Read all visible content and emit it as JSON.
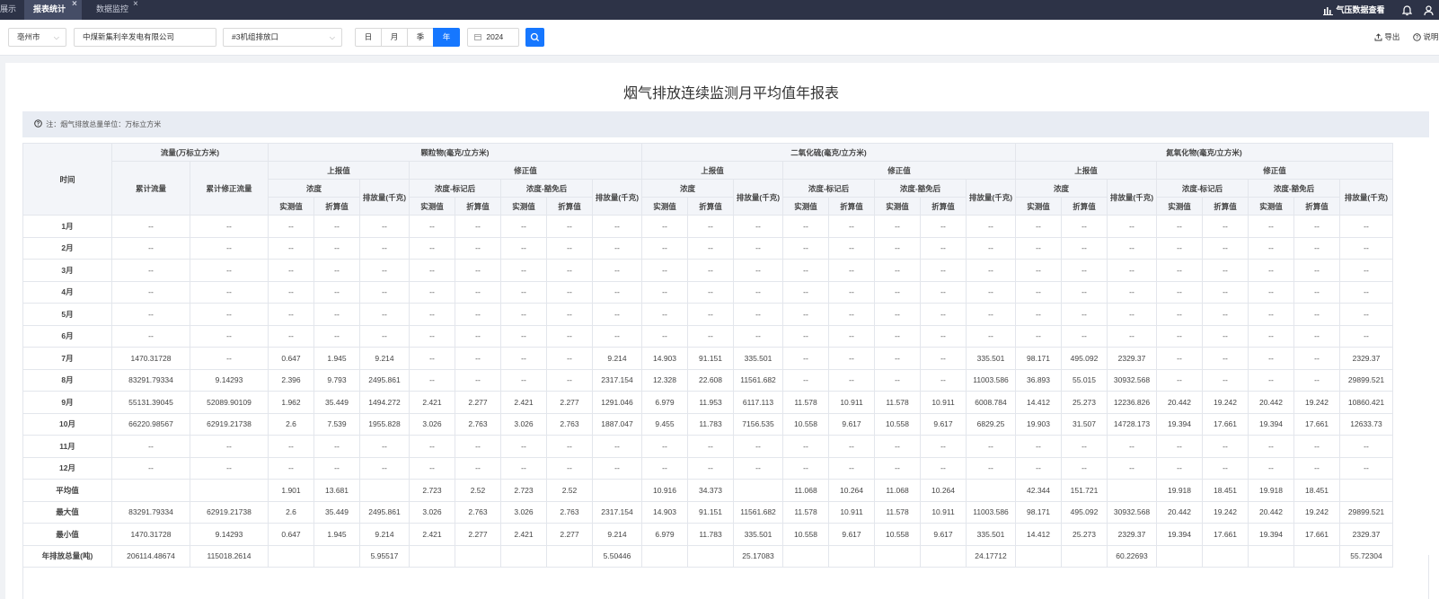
{
  "tabs": [
    {
      "label": "展示",
      "active": false,
      "closable": false
    },
    {
      "label": "报表统计",
      "active": true,
      "closable": true
    },
    {
      "label": "数据监控",
      "active": false,
      "closable": true
    }
  ],
  "topbar": {
    "pressure_label": "气压数据查看"
  },
  "filters": {
    "city": "亳州市",
    "company": "中煤新集利辛发电有限公司",
    "outlet": "#3机组排放口",
    "periods": [
      "日",
      "月",
      "季",
      "年"
    ],
    "active_period": "年",
    "year": "2024"
  },
  "toolbar": {
    "export_label": "导出",
    "help_label": "说明"
  },
  "report": {
    "title": "烟气排放连续监测月平均值年报表",
    "note": "注：烟气排放总量单位：万标立方米"
  },
  "table": {
    "header": {
      "time": "时间",
      "flow_group": "流量(万标立方米)",
      "cum_flow": "累计流量",
      "cum_corr_flow": "累计修正流量",
      "reported": "上报值",
      "corrected": "修正值",
      "concentration": "浓度",
      "conc_marked": "浓度-标记后",
      "conc_exempt": "浓度-豁免后",
      "emission": "排放量(千克)",
      "measured": "实测值",
      "converted": "折算值",
      "pollutants": [
        "颗粒物(毫克/立方米)",
        "二氧化硫(毫克/立方米)",
        "氮氧化物(毫克/立方米)"
      ]
    },
    "rows": [
      {
        "label": "1月",
        "cells": [
          "--",
          "--",
          "--",
          "--",
          "--",
          "--",
          "--",
          "--",
          "--",
          "--",
          "--",
          "--",
          "--",
          "--",
          "--",
          "--",
          "--",
          "--",
          "--",
          "--",
          "--",
          "--",
          "--",
          "--",
          "--",
          "--",
          "--",
          "--",
          "--",
          "--"
        ]
      },
      {
        "label": "2月",
        "cells": [
          "--",
          "--",
          "--",
          "--",
          "--",
          "--",
          "--",
          "--",
          "--",
          "--",
          "--",
          "--",
          "--",
          "--",
          "--",
          "--",
          "--",
          "--",
          "--",
          "--",
          "--",
          "--",
          "--",
          "--",
          "--",
          "--",
          "--",
          "--",
          "--",
          "--"
        ]
      },
      {
        "label": "3月",
        "cells": [
          "--",
          "--",
          "--",
          "--",
          "--",
          "--",
          "--",
          "--",
          "--",
          "--",
          "--",
          "--",
          "--",
          "--",
          "--",
          "--",
          "--",
          "--",
          "--",
          "--",
          "--",
          "--",
          "--",
          "--",
          "--",
          "--",
          "--",
          "--",
          "--",
          "--"
        ]
      },
      {
        "label": "4月",
        "cells": [
          "--",
          "--",
          "--",
          "--",
          "--",
          "--",
          "--",
          "--",
          "--",
          "--",
          "--",
          "--",
          "--",
          "--",
          "--",
          "--",
          "--",
          "--",
          "--",
          "--",
          "--",
          "--",
          "--",
          "--",
          "--",
          "--",
          "--",
          "--",
          "--",
          "--"
        ]
      },
      {
        "label": "5月",
        "cells": [
          "--",
          "--",
          "--",
          "--",
          "--",
          "--",
          "--",
          "--",
          "--",
          "--",
          "--",
          "--",
          "--",
          "--",
          "--",
          "--",
          "--",
          "--",
          "--",
          "--",
          "--",
          "--",
          "--",
          "--",
          "--",
          "--",
          "--",
          "--",
          "--",
          "--"
        ]
      },
      {
        "label": "6月",
        "cells": [
          "--",
          "--",
          "--",
          "--",
          "--",
          "--",
          "--",
          "--",
          "--",
          "--",
          "--",
          "--",
          "--",
          "--",
          "--",
          "--",
          "--",
          "--",
          "--",
          "--",
          "--",
          "--",
          "--",
          "--",
          "--",
          "--",
          "--",
          "--",
          "--",
          "--"
        ]
      },
      {
        "label": "7月",
        "cells": [
          "1470.31728",
          "--",
          "0.647",
          "1.945",
          "9.214",
          "--",
          "--",
          "--",
          "--",
          "9.214",
          "14.903",
          "91.151",
          "335.501",
          "--",
          "--",
          "--",
          "--",
          "335.501",
          "98.171",
          "495.092",
          "2329.37",
          "--",
          "--",
          "--",
          "--",
          "2329.37"
        ]
      },
      {
        "label": "8月",
        "cells": [
          "83291.79334",
          "9.14293",
          "2.396",
          "9.793",
          "2495.861",
          "--",
          "--",
          "--",
          "--",
          "2317.154",
          "12.328",
          "22.608",
          "11561.682",
          "--",
          "--",
          "--",
          "--",
          "11003.586",
          "36.893",
          "55.015",
          "30932.568",
          "--",
          "--",
          "--",
          "--",
          "29899.521"
        ]
      },
      {
        "label": "9月",
        "cells": [
          "55131.39045",
          "52089.90109",
          "1.962",
          "35.449",
          "1494.272",
          "2.421",
          "2.277",
          "2.421",
          "2.277",
          "1291.046",
          "6.979",
          "11.953",
          "6117.113",
          "11.578",
          "10.911",
          "11.578",
          "10.911",
          "6008.784",
          "14.412",
          "25.273",
          "12236.826",
          "20.442",
          "19.242",
          "20.442",
          "19.242",
          "10860.421"
        ]
      },
      {
        "label": "10月",
        "cells": [
          "66220.98567",
          "62919.21738",
          "2.6",
          "7.539",
          "1955.828",
          "3.026",
          "2.763",
          "3.026",
          "2.763",
          "1887.047",
          "9.455",
          "11.783",
          "7156.535",
          "10.558",
          "9.617",
          "10.558",
          "9.617",
          "6829.25",
          "19.903",
          "31.507",
          "14728.173",
          "19.394",
          "17.661",
          "19.394",
          "17.661",
          "12633.73"
        ]
      },
      {
        "label": "11月",
        "cells": [
          "--",
          "--",
          "--",
          "--",
          "--",
          "--",
          "--",
          "--",
          "--",
          "--",
          "--",
          "--",
          "--",
          "--",
          "--",
          "--",
          "--",
          "--",
          "--",
          "--",
          "--",
          "--",
          "--",
          "--",
          "--",
          "--"
        ]
      },
      {
        "label": "12月",
        "cells": [
          "--",
          "--",
          "--",
          "--",
          "--",
          "--",
          "--",
          "--",
          "--",
          "--",
          "--",
          "--",
          "--",
          "--",
          "--",
          "--",
          "--",
          "--",
          "--",
          "--",
          "--",
          "--",
          "--",
          "--",
          "--",
          "--"
        ]
      },
      {
        "label": "平均值",
        "cells": [
          "",
          "",
          "1.901",
          "13.681",
          "",
          "2.723",
          "2.52",
          "2.723",
          "2.52",
          "",
          "10.916",
          "34.373",
          "",
          "11.068",
          "10.264",
          "11.068",
          "10.264",
          "",
          "42.344",
          "151.721",
          "",
          "19.918",
          "18.451",
          "19.918",
          "18.451",
          ""
        ]
      },
      {
        "label": "最大值",
        "cells": [
          "83291.79334",
          "62919.21738",
          "2.6",
          "35.449",
          "2495.861",
          "3.026",
          "2.763",
          "3.026",
          "2.763",
          "2317.154",
          "14.903",
          "91.151",
          "11561.682",
          "11.578",
          "10.911",
          "11.578",
          "10.911",
          "11003.586",
          "98.171",
          "495.092",
          "30932.568",
          "20.442",
          "19.242",
          "20.442",
          "19.242",
          "29899.521"
        ]
      },
      {
        "label": "最小值",
        "cells": [
          "1470.31728",
          "9.14293",
          "0.647",
          "1.945",
          "9.214",
          "2.421",
          "2.277",
          "2.421",
          "2.277",
          "9.214",
          "6.979",
          "11.783",
          "335.501",
          "10.558",
          "9.617",
          "10.558",
          "9.617",
          "335.501",
          "14.412",
          "25.273",
          "2329.37",
          "19.394",
          "17.661",
          "19.394",
          "17.661",
          "2329.37"
        ]
      },
      {
        "label": "年排放总量(吨)",
        "cells": [
          "206114.48674",
          "115018.2614",
          "",
          "",
          "5.95517",
          "",
          "",
          "",
          "",
          "5.50446",
          "",
          "",
          "25.17083",
          "",
          "",
          "",
          "",
          "24.17712",
          "",
          "",
          "60.22693",
          "",
          "",
          "",
          "",
          "55.72304"
        ]
      }
    ]
  }
}
